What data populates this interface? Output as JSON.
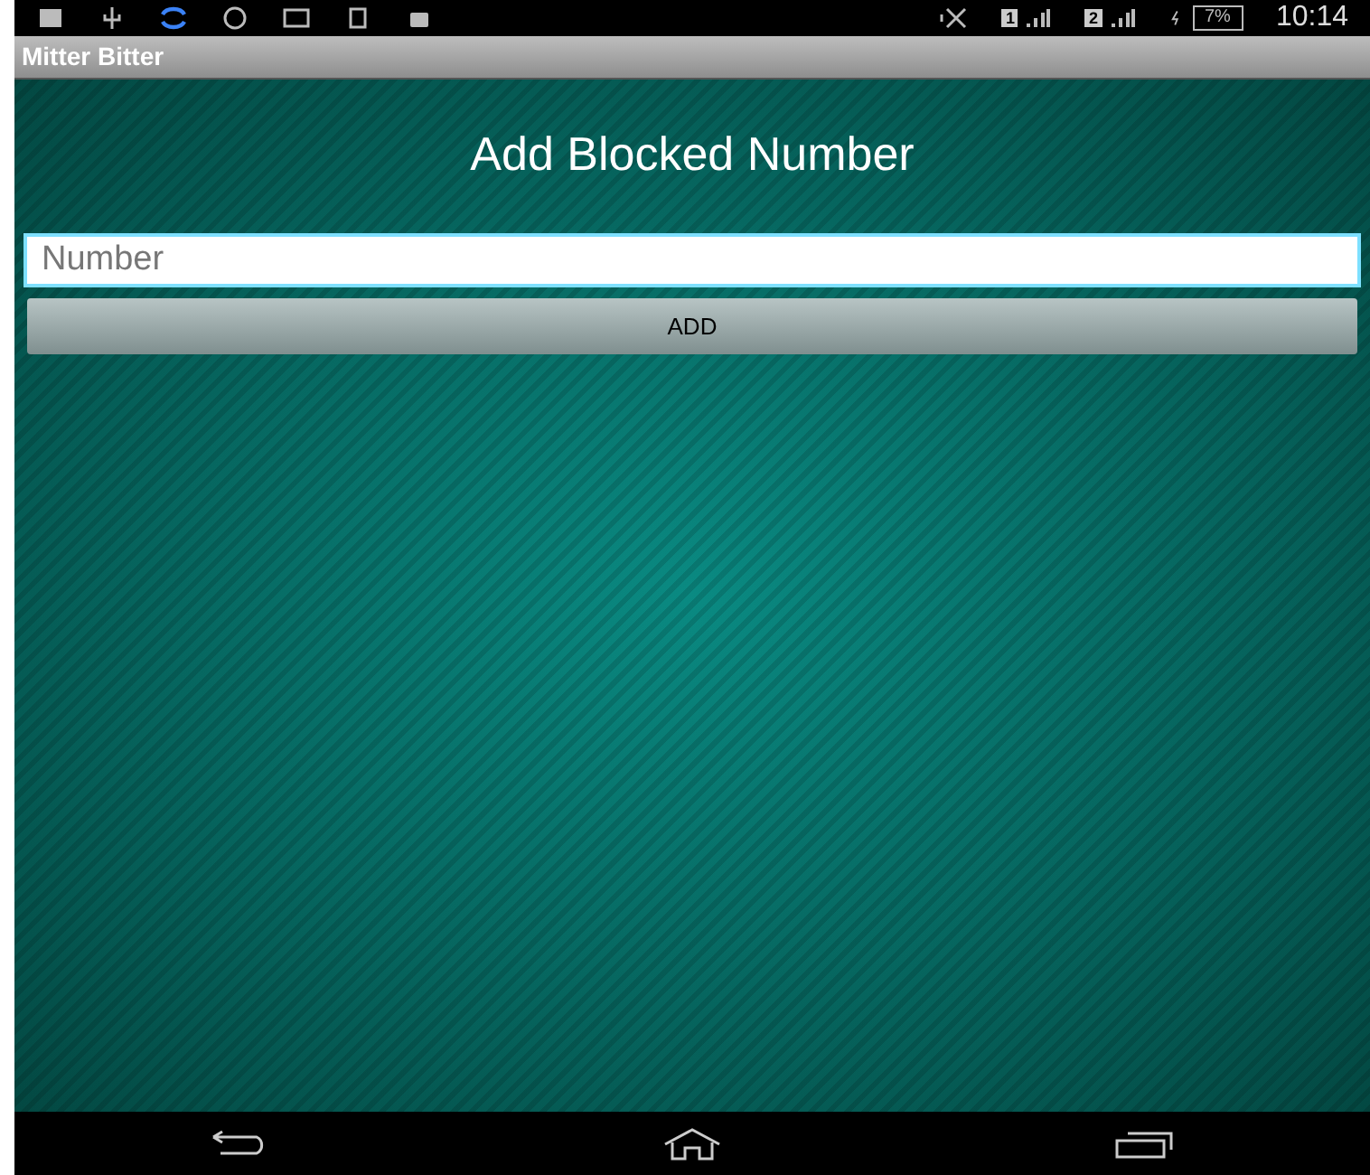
{
  "status_bar": {
    "sim_1": "1",
    "sim_2": "2",
    "battery": "7%",
    "time": "10:14"
  },
  "app_bar": {
    "title": "Mitter Bitter"
  },
  "heading": "Add Blocked Number",
  "number_field": {
    "placeholder": "Number"
  },
  "add_button": {
    "label": "ADD"
  }
}
